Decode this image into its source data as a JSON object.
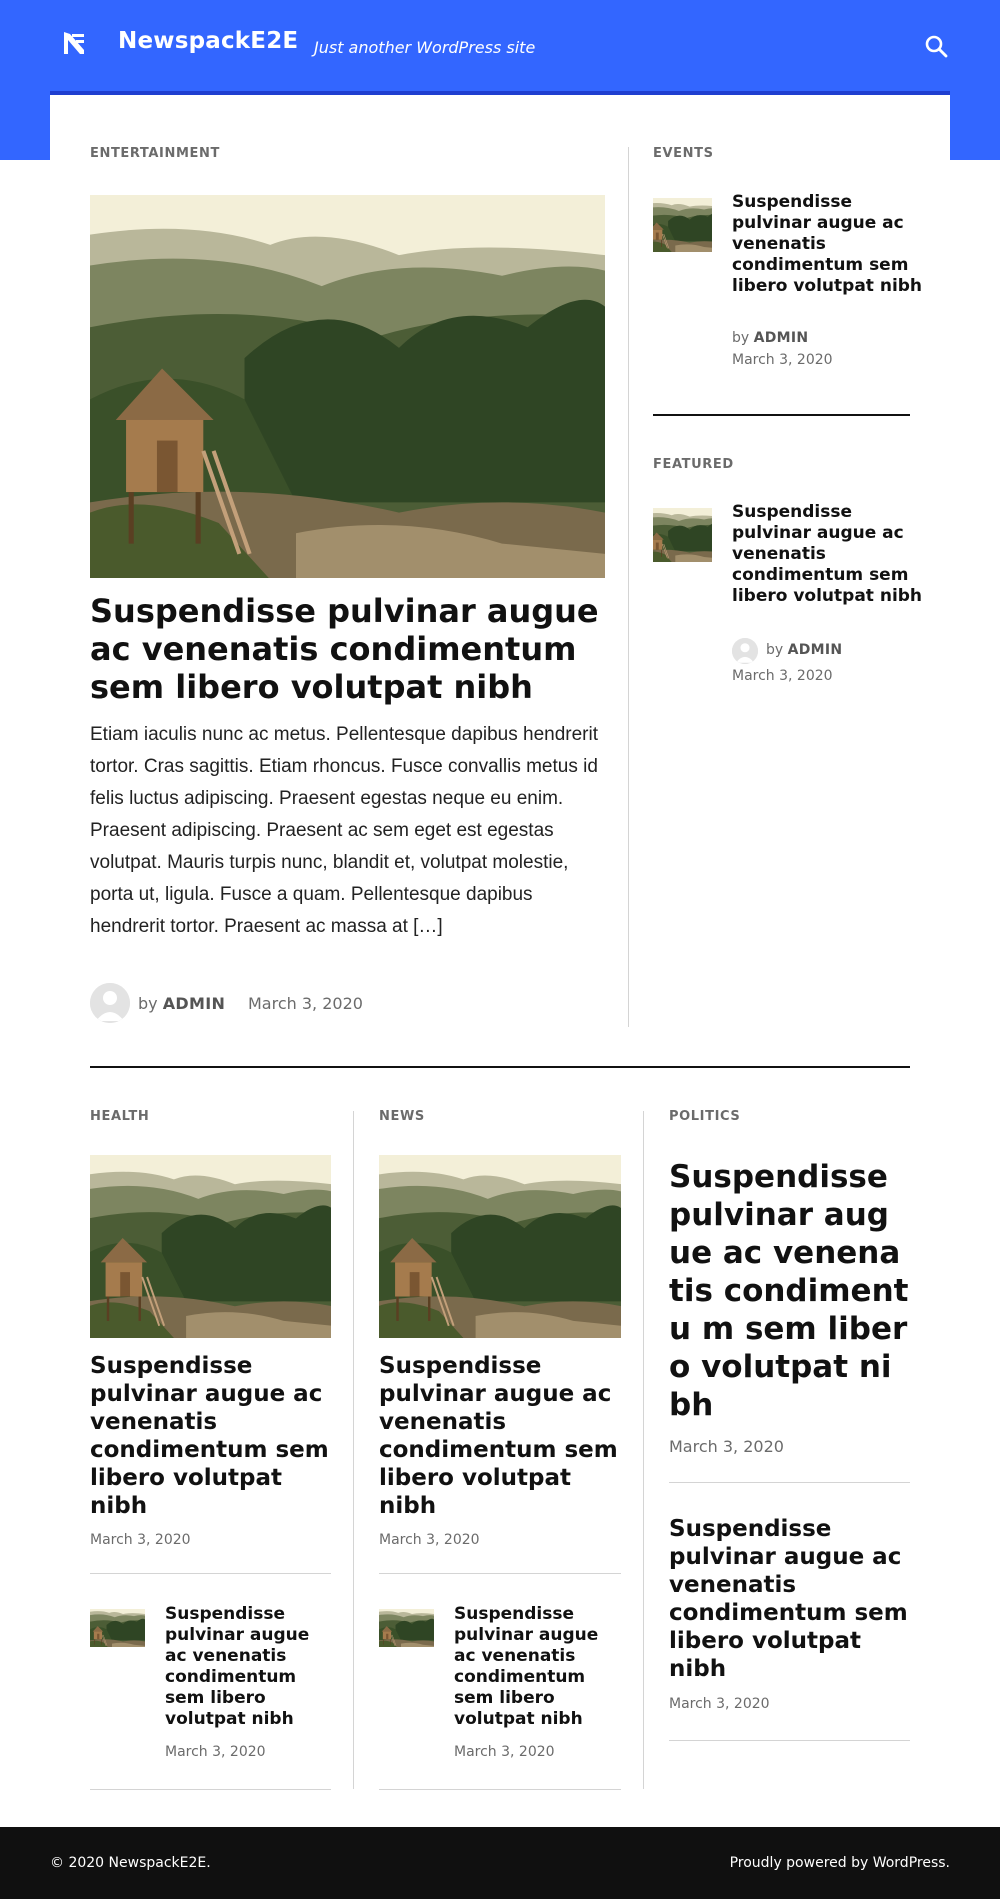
{
  "header": {
    "site_title": "NewspackE2E",
    "tagline": "Just another WordPress site",
    "logo_icon": "newspack-logo-icon",
    "search_icon": "search-icon",
    "brand_color": "#3366ff"
  },
  "top_section": {
    "main": {
      "category": "ENTERTAINMENT",
      "title": "Suspendisse pulvinar augue ac venenatis condimentum sem libero volutpat nibh",
      "excerpt": "Etiam iaculis nunc ac metus. Pellentesque dapibus hendrerit tortor. Cras sagittis. Etiam rhoncus. Fusce convallis metus id felis luctus adipiscing. Praesent egestas neque eu enim. Praesent adipiscing. Praesent ac sem eget est egestas volutpat. Mauris turpis nunc, blandit et, volutpat molestie, porta ut, ligula. Fusce a quam. Pellentesque dapibus hendrerit tortor. Praesent ac massa at […]",
      "by": "by",
      "author": "ADMIN",
      "date": "March 3, 2020"
    },
    "events": {
      "category": "EVENTS",
      "title": "Suspendisse pulvinar augue ac venenatis condimentum sem libero volutpat nibh",
      "by": "by",
      "author": "ADMIN",
      "date": "March 3, 2020"
    },
    "featured": {
      "category": "FEATURED",
      "title": "Suspendisse pulvinar augue ac venenatis condimentum sem libero volutpat nibh",
      "by": "by",
      "author": "ADMIN",
      "date": "March 3, 2020"
    }
  },
  "bottom_section": {
    "health": {
      "category": "HEALTH",
      "big_title": "Suspendisse pulvinar augue ac venenatis condimentum sem libero volutpat nibh",
      "big_date": "March 3, 2020",
      "small_title": "Suspendisse pulvinar augue ac venenatis condimentum sem libero volutpat nibh",
      "small_date": "March 3, 2020"
    },
    "news": {
      "category": "NEWS",
      "big_title": "Suspendisse pulvinar augue ac venenatis condimentum sem libero volutpat nibh",
      "big_date": "March 3, 2020",
      "small_title": "Suspendisse pulvinar augue ac venenatis condimentum sem libero volutpat nibh",
      "small_date": "March 3, 2020"
    },
    "politics": {
      "category": "POLITICS",
      "title_1": "Suspendisse pulvinar augue ac venenatis condimentu m sem libero volutpat nibh",
      "date_1": "March 3, 2020",
      "title_2": "Suspendisse pulvinar augue ac venenatis condimentum sem libero volutpat nibh",
      "date_2": "March 3, 2020"
    }
  },
  "footer": {
    "copyright": "© 2020 NewspackE2E.",
    "powered": "Proudly powered by WordPress."
  }
}
